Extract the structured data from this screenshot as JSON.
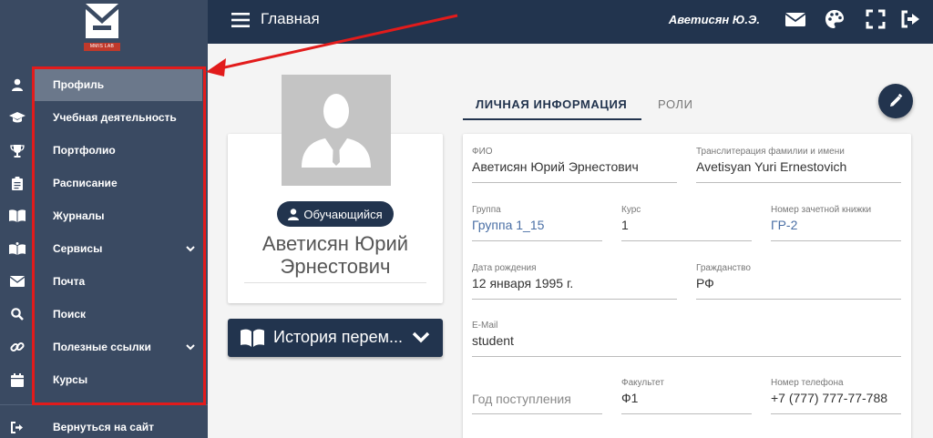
{
  "logo": {
    "text": "MMIS LAB"
  },
  "sidebar": {
    "items": [
      {
        "label": "Профиль",
        "icon": "user-icon"
      },
      {
        "label": "Учебная деятельность",
        "icon": "graduation-cap-icon"
      },
      {
        "label": "Портфолио",
        "icon": "trophy-icon"
      },
      {
        "label": "Расписание",
        "icon": "clipboard-icon"
      },
      {
        "label": "Журналы",
        "icon": "book-open-icon"
      },
      {
        "label": "Сервисы",
        "icon": "book-reader-icon"
      },
      {
        "label": "Почта",
        "icon": "envelope-icon"
      },
      {
        "label": "Поиск",
        "icon": "search-icon"
      },
      {
        "label": "Полезные ссылки",
        "icon": "link-icon"
      },
      {
        "label": "Курсы",
        "icon": "calendar-icon"
      }
    ],
    "back": {
      "label": "Вернуться на сайт",
      "icon": "sign-out-icon"
    }
  },
  "header": {
    "title": "Главная",
    "user": "Аветисян Ю.Э."
  },
  "profile": {
    "role": "Обучающийся",
    "name_line1": "Аветисян Юрий",
    "name_line2": "Эрнестович",
    "history_label": "История перем..."
  },
  "tabs": [
    {
      "label": "ЛИЧНАЯ ИНФОРМАЦИЯ",
      "active": true
    },
    {
      "label": "РОЛИ",
      "active": false
    }
  ],
  "form": {
    "fio": {
      "label": "ФИО",
      "value": "Аветисян Юрий Эрнестович"
    },
    "translit": {
      "label": "Транслитерация фамилии и имени",
      "value": "Avetisyan Yuri Ernestovich"
    },
    "group": {
      "label": "Группа",
      "value": "Группа 1_15"
    },
    "course": {
      "label": "Курс",
      "value": "1"
    },
    "record_book": {
      "label": "Номер зачетной книжки",
      "value": "ГР-2"
    },
    "birth_date": {
      "label": "Дата рождения",
      "value": "12 января 1995 г."
    },
    "citizenship": {
      "label": "Гражданство",
      "value": "РФ"
    },
    "email": {
      "label": "E-Mail",
      "value": "student"
    },
    "admission_year": {
      "placeholder": "Год поступления"
    },
    "faculty": {
      "label": "Факультет",
      "value": "Ф1"
    },
    "phone": {
      "label": "Номер телефона",
      "value": "+7 (777) 777-77-788"
    }
  },
  "colors": {
    "sidebar": "#3a4a62",
    "topbar": "#22344e",
    "highlight": "#e21b1b"
  }
}
